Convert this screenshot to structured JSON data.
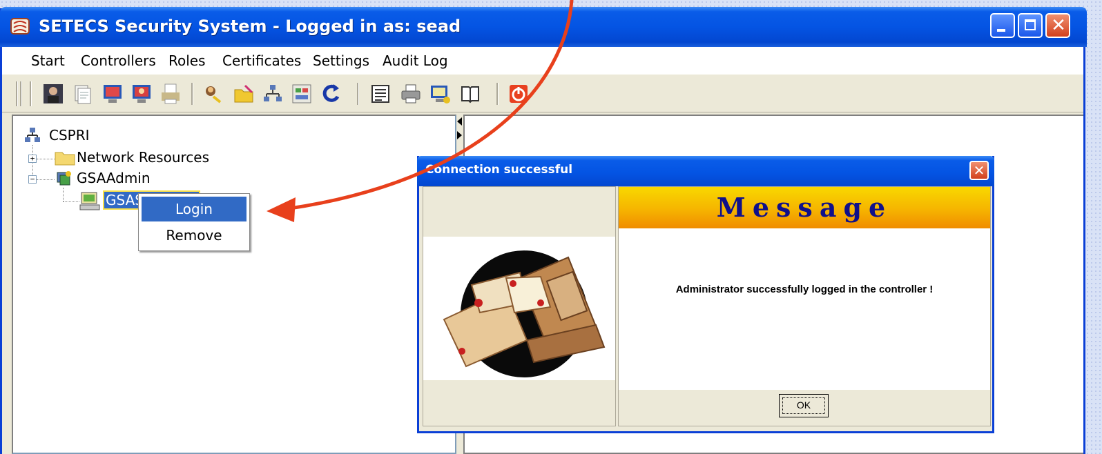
{
  "window": {
    "title": "SETECS Security System - Logged in as: sead",
    "app_icon": "setecs-app-icon",
    "controls": [
      "minimize-icon",
      "maximize-icon",
      "close-icon"
    ]
  },
  "menu": {
    "items": [
      "Start",
      "Controllers",
      "Roles",
      "Certificates",
      "Settings",
      "Audit Log"
    ]
  },
  "toolbar": {
    "icons": [
      "user-admin-icon",
      "documents-icon",
      "monitor-red-icon",
      "monitor-user-icon",
      "printer-doc-icon",
      "keys-user-icon",
      "folder-edit-icon",
      "network-icon",
      "form-icon",
      "refresh-icon",
      "list-icon",
      "print-icon",
      "monitor-info-icon",
      "book-icon",
      "power-icon"
    ]
  },
  "tree": {
    "root": "CSPRI",
    "nodes": [
      {
        "label": "Network Resources",
        "expander": "+"
      },
      {
        "label": "GSAAdmin",
        "expander": "−"
      },
      {
        "label": "GSAServer53"
      }
    ]
  },
  "context_menu": {
    "items": [
      "Login",
      "Remove"
    ]
  },
  "dialog": {
    "title": "Connection successful",
    "close_glyph": "✕",
    "banner": "Message",
    "message": "Administrator successfully logged in the controller !",
    "ok_label": "OK"
  },
  "colors": {
    "titlebar": "#0454e3",
    "selection": "#316ac5",
    "arrow": "#e8401c",
    "banner_text": "#10108a"
  }
}
